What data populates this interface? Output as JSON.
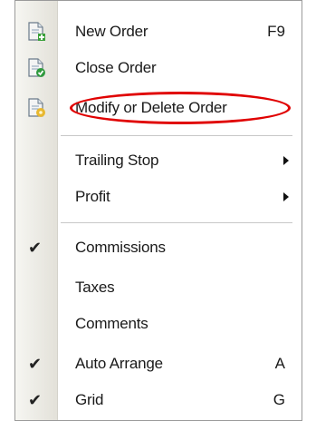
{
  "menu": {
    "items": [
      {
        "label": "New Order",
        "shortcut": "F9",
        "icon": "new-order-doc-icon"
      },
      {
        "label": "Close Order",
        "shortcut": "",
        "icon": "close-order-doc-icon"
      },
      {
        "label": "Modify or Delete Order",
        "shortcut": "",
        "icon": "modify-order-doc-icon"
      },
      {
        "label": "Trailing Stop",
        "shortcut": "",
        "submenu": true
      },
      {
        "label": "Profit",
        "shortcut": "",
        "submenu": true
      },
      {
        "label": "Commissions",
        "checked": true
      },
      {
        "label": "Taxes",
        "checked": false
      },
      {
        "label": "Comments",
        "checked": false
      },
      {
        "label": "Auto Arrange",
        "shortcut": "A",
        "checked": true
      },
      {
        "label": "Grid",
        "shortcut": "G",
        "checked": true
      }
    ],
    "check_glyph": "✔",
    "highlight_color": "#e00000"
  }
}
